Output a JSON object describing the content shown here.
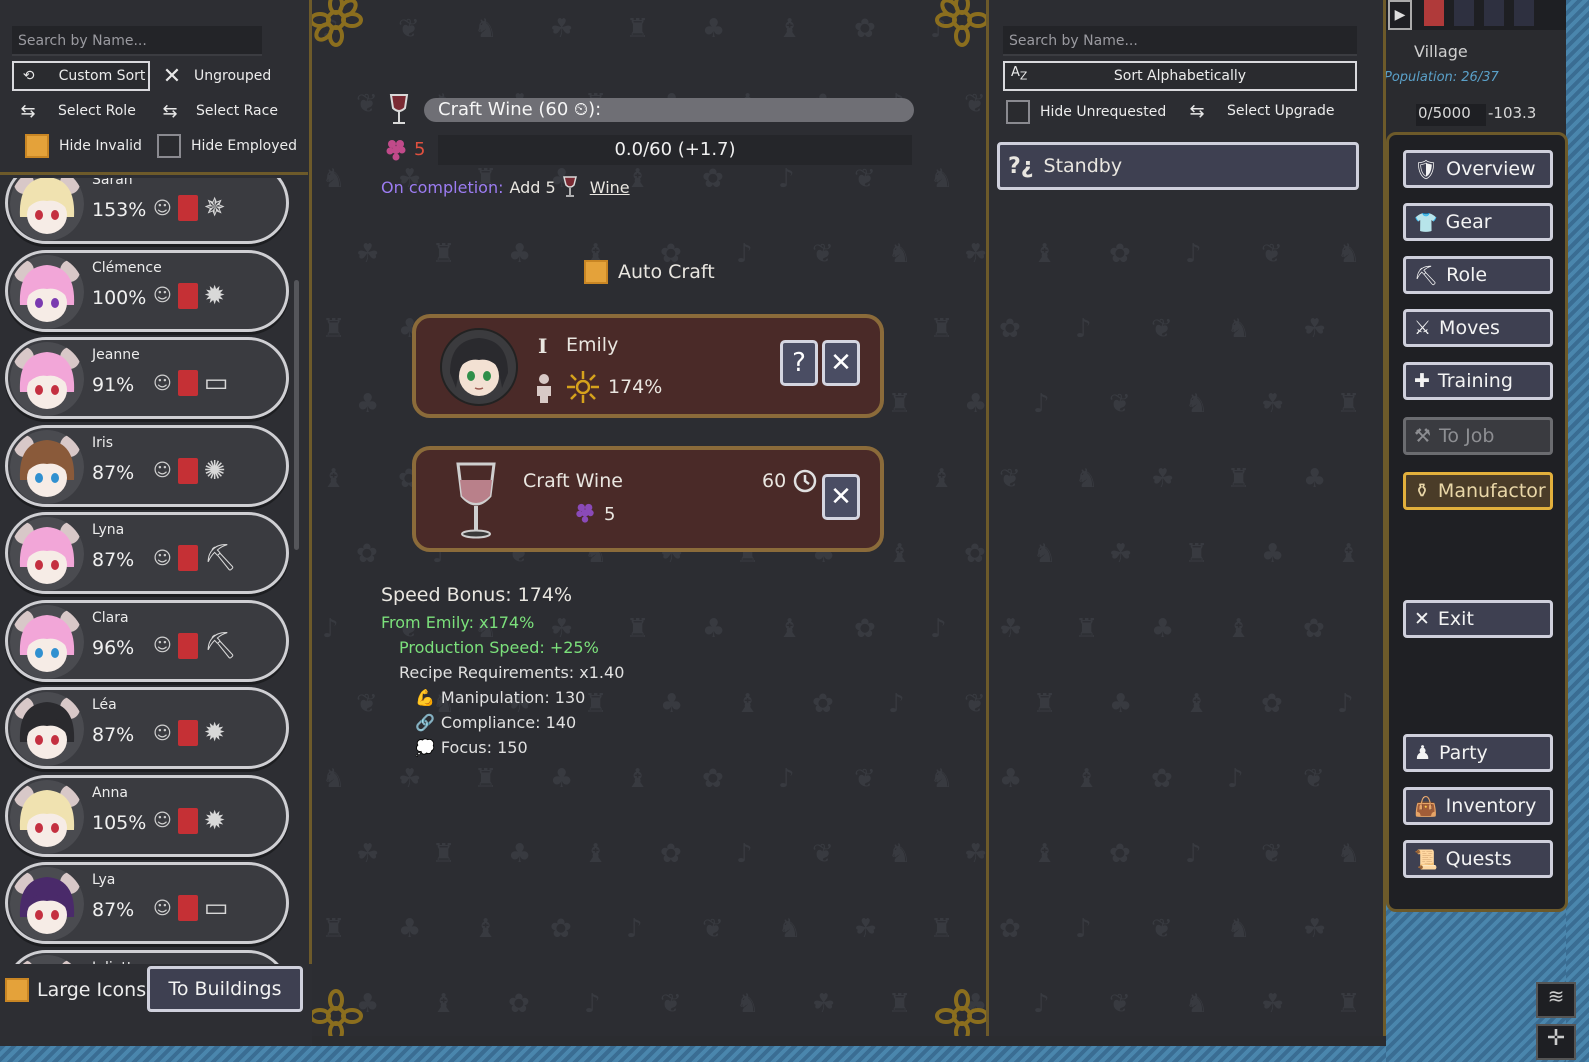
{
  "left_panel": {
    "search_placeholder": "Search by Name...",
    "custom_sort": "Custom Sort",
    "ungrouped": "Ungrouped",
    "select_role": "Select Role",
    "select_race": "Select Race",
    "hide_invalid": "Hide Invalid",
    "hide_employed": "Hide Employed",
    "characters": [
      {
        "name": "Sarah",
        "pct": "153%"
      },
      {
        "name": "Clémence",
        "pct": "100%"
      },
      {
        "name": "Jeanne",
        "pct": "91%"
      },
      {
        "name": "Iris",
        "pct": "87%"
      },
      {
        "name": "Lyna",
        "pct": "87%"
      },
      {
        "name": "Clara",
        "pct": "96%"
      },
      {
        "name": "Léa",
        "pct": "87%"
      },
      {
        "name": "Anna",
        "pct": "105%"
      },
      {
        "name": "Lya",
        "pct": "87%"
      },
      {
        "name": "Juliette",
        "pct": ""
      }
    ],
    "large_icons": "Large Icons",
    "to_buildings": "To Buildings"
  },
  "craft": {
    "title": "Craft Wine (60 ⏲):",
    "grapes": "5",
    "progress": "0.0/60 (+1.7)",
    "on_completion_label": "On completion:",
    "on_completion_text": "Add 5",
    "on_completion_item": "Wine",
    "auto_craft": "Auto Craft",
    "worker": {
      "rank": "I",
      "name": "Emily",
      "pct": "174%"
    },
    "recipe": {
      "name": "Craft Wine",
      "time": "60",
      "cost": "5"
    },
    "bonus": {
      "speed": "Speed Bonus: 174%",
      "from": "From Emily: x174%",
      "production": "Production Speed: +25%",
      "requirements": "Recipe Requirements: x1.40",
      "manipulation": "Manipulation: 130",
      "compliance": "Compliance: 140",
      "focus": "Focus: 150"
    }
  },
  "right_panel": {
    "search_placeholder": "Search by Name...",
    "sort_alpha": "Sort Alphabetically",
    "hide_unrequested": "Hide Unrequested",
    "select_upgrade": "Select Upgrade",
    "standby": "Standby"
  },
  "village": {
    "title": "Village",
    "population": "Population: 26/37",
    "storage": "0/5000",
    "balance": "-103.3"
  },
  "menu": {
    "overview": "Overview",
    "gear": "Gear",
    "role": "Role",
    "moves": "Moves",
    "training": "Training",
    "to_job": "To Job",
    "manufactor": "Manufactor",
    "exit": "Exit",
    "party": "Party",
    "inventory": "Inventory",
    "quests": "Quests"
  },
  "colors": {
    "accent_orange": "#e4a23a",
    "gold_border": "#6d5a2a",
    "completion_purple": "#9c7cf2",
    "bonus_green": "#7be07b",
    "card_maroon": "#4a2a28"
  }
}
